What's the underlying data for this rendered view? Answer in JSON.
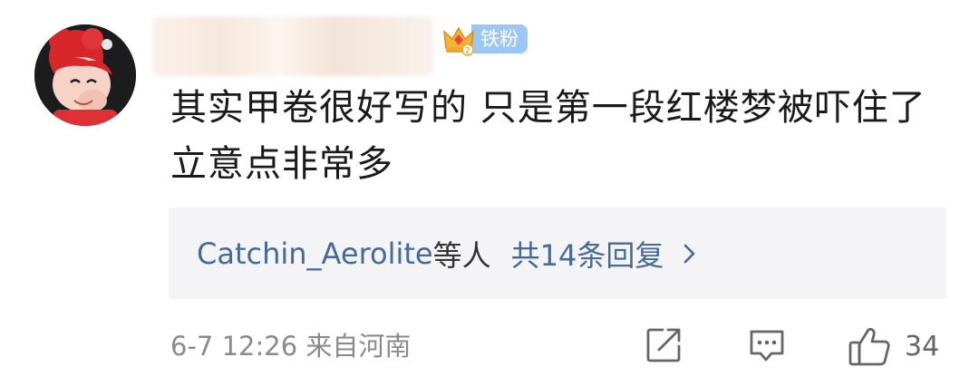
{
  "comment": {
    "badge_label": "铁粉",
    "text": "其实甲卷很好写的 只是第一段红楼梦被吓住了 立意点非常多",
    "replies": {
      "user": "Catchin_Aerolite",
      "suffix": "等人",
      "count_label": "共14条回复"
    },
    "meta": {
      "time_location": "6-7 12:26 来自河南"
    },
    "actions": {
      "share_icon": "share-icon",
      "comment_icon": "comment-icon",
      "like_icon": "thumbs-up-icon",
      "like_count": "34"
    }
  },
  "colors": {
    "link": "#45699a",
    "badge": "#9cc6f6",
    "text": "#1a1a1a",
    "meta": "#8a8a8a"
  }
}
